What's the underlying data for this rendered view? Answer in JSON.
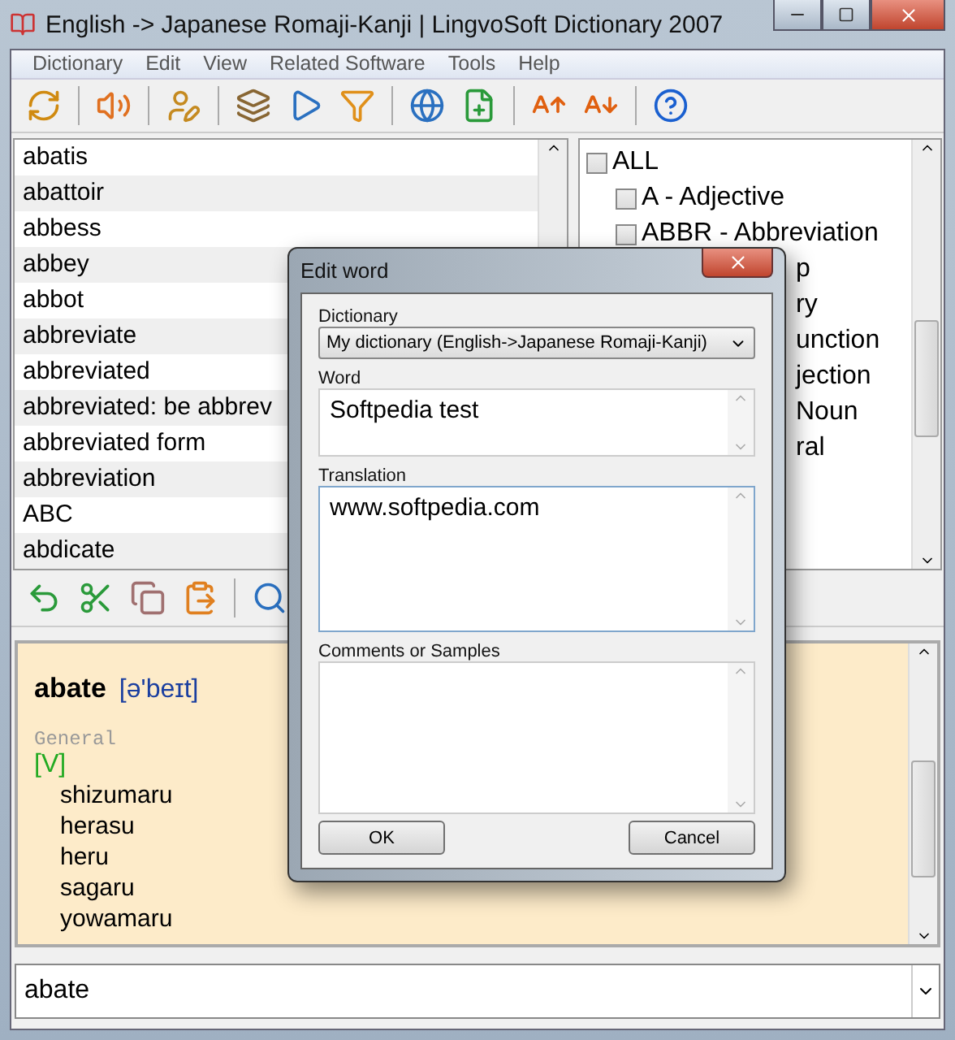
{
  "window": {
    "title": "English -> Japanese Romaji-Kanji | LingvoSoft Dictionary 2007"
  },
  "menu": [
    "Dictionary",
    "Edit",
    "View",
    "Related Software",
    "Tools",
    "Help"
  ],
  "word_list": [
    "abatis",
    "abattoir",
    "abbess",
    "abbey",
    "abbot",
    "abbreviate",
    "abbreviated",
    "abbreviated: be abbrev",
    "abbreviated form",
    "abbreviation",
    "ABC",
    "abdicate"
  ],
  "categories": {
    "label": "ALL",
    "checked": false,
    "children": [
      {
        "kind": "item",
        "label": "A - Adjective",
        "checked": false
      },
      {
        "kind": "item",
        "label": "ABBR - Abbreviation",
        "checked": false
      },
      {
        "kind": "fragment",
        "label": "p"
      },
      {
        "kind": "fragment",
        "label": "ry"
      },
      {
        "kind": "fragment",
        "label": "unction"
      },
      {
        "kind": "fragment",
        "label": "jection"
      },
      {
        "kind": "fragment",
        "label": "Noun"
      },
      {
        "kind": "fragment",
        "label": "ral"
      }
    ]
  },
  "entry": {
    "headword": "abate",
    "transcription": "[ə'beɪt]",
    "section": "General",
    "part_of_speech": "[V]",
    "translations": [
      "shizumaru",
      "herasu",
      "heru",
      "sagaru",
      "yowamaru"
    ]
  },
  "search_input": {
    "value": "abate"
  },
  "dialog": {
    "title": "Edit word",
    "dictionary_label": "Dictionary",
    "dictionary_value": "My dictionary (English->Japanese Romaji-Kanji)",
    "word_label": "Word",
    "word_value": "Softpedia test",
    "translation_label": "Translation",
    "translation_value": "www.softpedia.com",
    "comments_label": "Comments or Samples",
    "buttons": [
      "OK",
      "Cancel"
    ]
  }
}
